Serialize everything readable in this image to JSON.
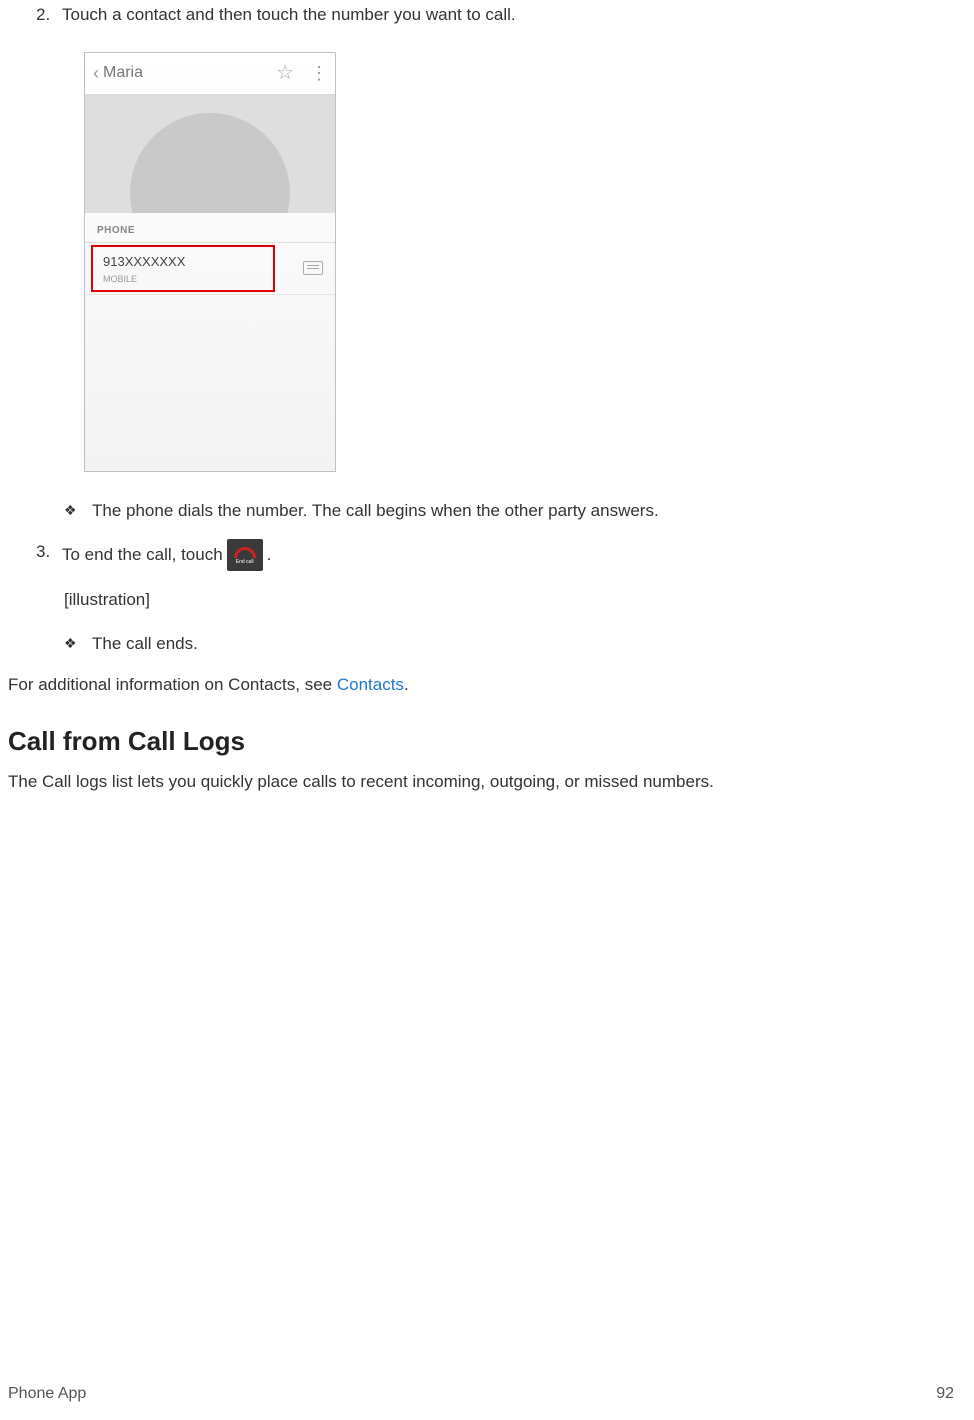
{
  "step2": {
    "num": "2.",
    "text": "Touch a contact and then touch the number you want to call."
  },
  "screenshot": {
    "contact_name": "Maria",
    "section_label": "PHONE",
    "phone_number": "913XXXXXXX",
    "phone_type": "MOBILE"
  },
  "sub_bullet_1": "The phone dials the number. The call begins when the other party answers.",
  "step3": {
    "num": "3.",
    "prefix": "To end the call, touch",
    "suffix": ".",
    "icon_label": "End call"
  },
  "illustration_placeholder": "[illustration]",
  "sub_bullet_2": "The call ends.",
  "closing_para_prefix": "For additional information on Contacts, see ",
  "closing_link": "Contacts",
  "closing_para_suffix": ".",
  "heading": "Call from Call Logs",
  "heading_sub": "The Call logs list lets you quickly place calls to recent incoming, outgoing, or missed numbers.",
  "footer_left": "Phone App",
  "footer_right": "92"
}
